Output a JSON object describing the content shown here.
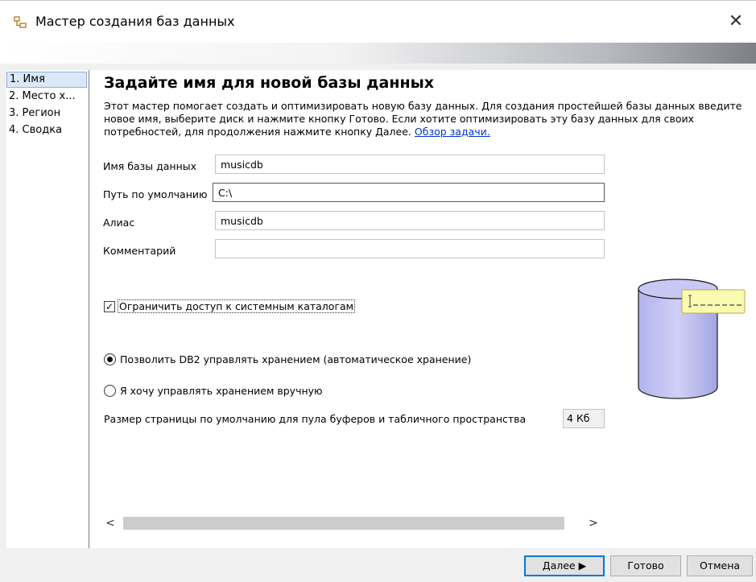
{
  "window": {
    "title": "Мастер создания баз данных",
    "close_glyph": "✕"
  },
  "sidebar": {
    "items": [
      {
        "label": "1. Имя",
        "selected": true
      },
      {
        "label": "2. Место х..."
      },
      {
        "label": "3. Регион"
      },
      {
        "label": "4. Сводка"
      }
    ]
  },
  "main": {
    "heading": "Задайте имя для новой базы данных",
    "description": "Этот мастер помогает создать и оптимизировать новую базу данных. Для создания простейшей базы данных введите новое имя, выберите диск и нажмите кнопку Готово. Если хотите оптимизировать эту базу данных для своих потребностей, для продолжения нажмите кнопку Далее.",
    "overview_link": "Обзор задачи.",
    "fields": {
      "db_name": {
        "label": "Имя базы данных",
        "value": "musicdb"
      },
      "default_path": {
        "label": "Путь по умолчанию",
        "value": "C:\\"
      },
      "alias": {
        "label": "Алиас",
        "value": "musicdb"
      },
      "comment": {
        "label": "Комментарий",
        "value": ""
      }
    },
    "restrict_access": {
      "label": "Ограничить доступ к системным каталогам",
      "checked": true,
      "check_glyph": "✓"
    },
    "storage": {
      "auto_label": "Позволить DB2 управлять хранением (автоматическое хранение)",
      "manual_label": "Я хочу управлять хранением вручную",
      "selected": "auto"
    },
    "page_size": {
      "label": "Размер страницы по умолчанию для пула буферов и табличного пространства",
      "value": "4 Кб"
    },
    "scroll": {
      "left_arrow": "<",
      "right_arrow": ">"
    }
  },
  "buttons": {
    "next": "Далее ▶",
    "finish": "Готово",
    "cancel": "Отмена"
  },
  "colors": {
    "cylinder": "#b8b8f0",
    "tag": "#fafab0",
    "link": "#0033cc",
    "primary_border": "#0078d7"
  },
  "icons": {
    "title_icon": "wizard-icon",
    "illustration": "database-cylinder-icon"
  }
}
